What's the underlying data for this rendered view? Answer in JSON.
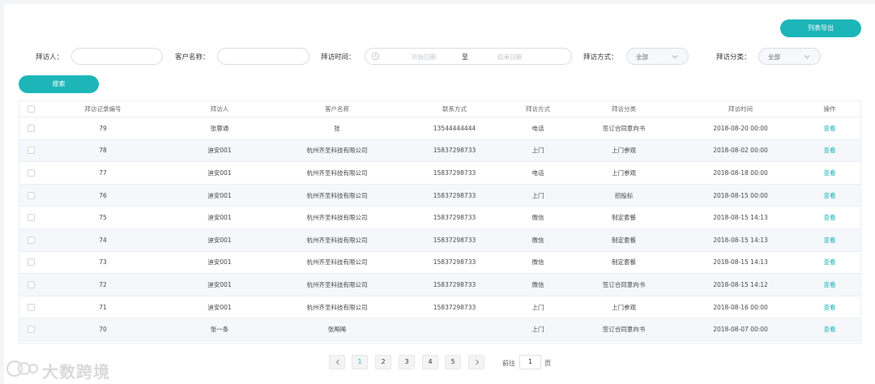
{
  "toolbar": {
    "export_label": "列表导出",
    "search_label": "搜索"
  },
  "filters": {
    "visitor_label": "拜访人：",
    "customer_label": "客户名称：",
    "time_label": "拜访时间：",
    "start_placeholder": "开始日期",
    "range_separator": "至",
    "end_placeholder": "结束日期",
    "method_label": "拜访方式：",
    "method_value": "全部",
    "category_label": "拜访分类：",
    "category_value": "全部"
  },
  "table": {
    "headers": [
      "拜访记录编号",
      "拜访人",
      "客户名称",
      "联系方式",
      "拜访方式",
      "拜访分类",
      "拜访时间",
      "操作"
    ],
    "rows": [
      [
        "79",
        "张蓉通",
        "张",
        "13544444444",
        "电话",
        "签订合同意向书",
        "2018-08-20 00:00",
        "查看"
      ],
      [
        "78",
        "迪安001",
        "杭州齐圣科技有限公司",
        "15837298733",
        "上门",
        "上门参观",
        "2018-08-02 00:00",
        "查看"
      ],
      [
        "77",
        "迪安001",
        "杭州齐圣科技有限公司",
        "15837298733",
        "电话",
        "上门参观",
        "2018-08-18 00:00",
        "查看"
      ],
      [
        "76",
        "迪安001",
        "杭州齐圣科技有限公司",
        "15837298733",
        "上门",
        "招投标",
        "2018-08-15 00:00",
        "查看"
      ],
      [
        "75",
        "迪安001",
        "杭州齐圣科技有限公司",
        "15837298733",
        "微信",
        "制定套餐",
        "2018-08-15 14:13",
        "查看"
      ],
      [
        "74",
        "迪安001",
        "杭州齐圣科技有限公司",
        "15837298733",
        "微信",
        "制定套餐",
        "2018-08-15 14:13",
        "查看"
      ],
      [
        "73",
        "迪安001",
        "杭州齐圣科技有限公司",
        "15837298733",
        "微信",
        "制定套餐",
        "2018-08-15 14:13",
        "查看"
      ],
      [
        "72",
        "迪安001",
        "杭州齐圣科技有限公司",
        "15837298733",
        "微信",
        "签订合同意向书",
        "2018-08-15 14:12",
        "查看"
      ],
      [
        "71",
        "迪安001",
        "杭州齐圣科技有限公司",
        "15837298733",
        "上门",
        "上门参观",
        "2018-08-16 00:00",
        "查看"
      ],
      [
        "70",
        "张一条",
        "张飚飚",
        "",
        "上门",
        "签订合同意向书",
        "2018-08-07 00:00",
        "查看"
      ]
    ]
  },
  "pagination": {
    "pages": [
      "1",
      "2",
      "3",
      "4",
      "5"
    ],
    "current": "1",
    "goto_prefix": "前往",
    "goto_value": "1",
    "goto_suffix": "页"
  },
  "watermark": {
    "text": "大数跨境"
  },
  "colors": {
    "accent": "#1cb5b8",
    "stripe": "#f5f7fa",
    "border": "#ebeef5"
  }
}
